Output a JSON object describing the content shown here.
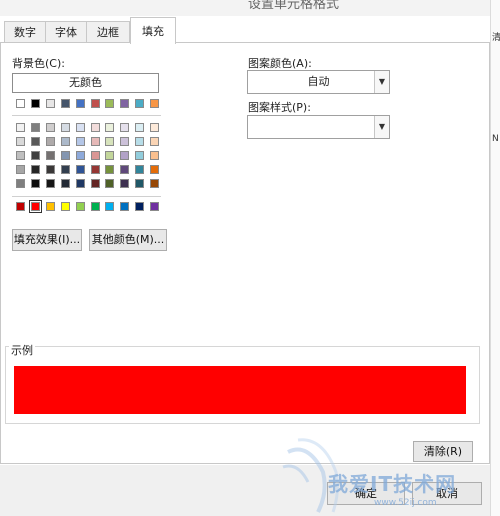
{
  "dialog": {
    "title": "设置单元格格式",
    "tabs": [
      {
        "label": "数字",
        "active": false
      },
      {
        "label": "字体",
        "active": false
      },
      {
        "label": "边框",
        "active": false
      },
      {
        "label": "填充",
        "active": true
      }
    ]
  },
  "background_color": {
    "label": "背景色(C):",
    "no_color_button": "无颜色",
    "standard_row": [
      "#ffffff",
      "#000000",
      "#e7e6e6",
      "#44546a",
      "#4472c4",
      "#c0504d",
      "#9bbb59",
      "#8064a2",
      "#4bacc6",
      "#f79646"
    ],
    "theme_rows": [
      [
        "#f2f2f2",
        "#7f7f7f",
        "#d0cece",
        "#d6dce4",
        "#d9e1f2",
        "#f2dcdb",
        "#ebf1dd",
        "#e5e0ec",
        "#dbeef3",
        "#fdeada"
      ],
      [
        "#d9d9d9",
        "#595959",
        "#aeaaaa",
        "#acb9ca",
        "#b4c6e7",
        "#e6b9b8",
        "#d7e3bc",
        "#ccc1d9",
        "#b7dde8",
        "#fbd5b5"
      ],
      [
        "#bfbfbf",
        "#3f3f3f",
        "#757171",
        "#8496b0",
        "#8eaadb",
        "#d99694",
        "#c3d69b",
        "#b2a2c7",
        "#92cddc",
        "#fac08f"
      ],
      [
        "#a6a6a6",
        "#262626",
        "#3a3838",
        "#333f4f",
        "#2f5496",
        "#953734",
        "#76923c",
        "#5f497a",
        "#31859b",
        "#e36c09"
      ],
      [
        "#7f7f7f",
        "#0c0c0c",
        "#161616",
        "#222a35",
        "#1f3864",
        "#632423",
        "#4f6128",
        "#3f3151",
        "#205867",
        "#974806"
      ]
    ],
    "standard_colors": [
      "#c00000",
      "#ff0000",
      "#ffc000",
      "#ffff00",
      "#92d050",
      "#00b050",
      "#00b0f0",
      "#0070c0",
      "#002060",
      "#7030a0"
    ],
    "selected_color": "#ff0000",
    "fill_effects_button": "填充效果(I)...",
    "more_colors_button": "其他颜色(M)..."
  },
  "pattern": {
    "color_label": "图案颜色(A):",
    "color_value": "自动",
    "style_label": "图案样式(P):",
    "style_value": ""
  },
  "sample": {
    "label": "示例",
    "fill_color": "#ff0000"
  },
  "buttons": {
    "clear": "清除(R)",
    "ok": "确定",
    "cancel": "取消"
  },
  "side_strip": {
    "chars": [
      "清",
      "N"
    ]
  },
  "watermark": {
    "text": "我爱IT技术网",
    "sub": "www.52ij.com"
  }
}
